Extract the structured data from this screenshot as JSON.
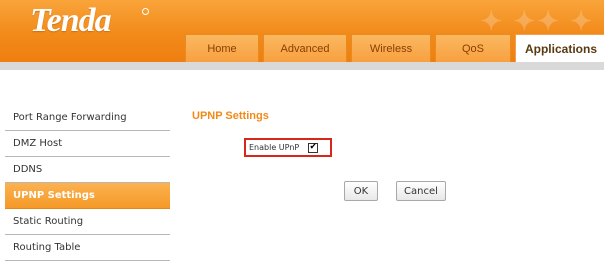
{
  "brand": {
    "logo": "Tenda"
  },
  "tabs": [
    {
      "label": "Home",
      "active": false
    },
    {
      "label": "Advanced",
      "active": false
    },
    {
      "label": "Wireless",
      "active": false
    },
    {
      "label": "QoS",
      "active": false
    },
    {
      "label": "Applications",
      "active": true
    }
  ],
  "sidebar": {
    "items": [
      {
        "label": "Port Range Forwarding",
        "active": false
      },
      {
        "label": "DMZ Host",
        "active": false
      },
      {
        "label": "DDNS",
        "active": false
      },
      {
        "label": "UPNP Settings",
        "active": true
      },
      {
        "label": "Static Routing",
        "active": false
      },
      {
        "label": "Routing Table",
        "active": false
      }
    ]
  },
  "main": {
    "title": "UPNP Settings",
    "enable_upnp": {
      "label": "Enable UPnP",
      "checked": true,
      "check_glyph": "✔"
    },
    "ok_label": "OK",
    "cancel_label": "Cancel"
  },
  "colors": {
    "accent": "#f28a1a",
    "highlight": "#d9261c"
  }
}
